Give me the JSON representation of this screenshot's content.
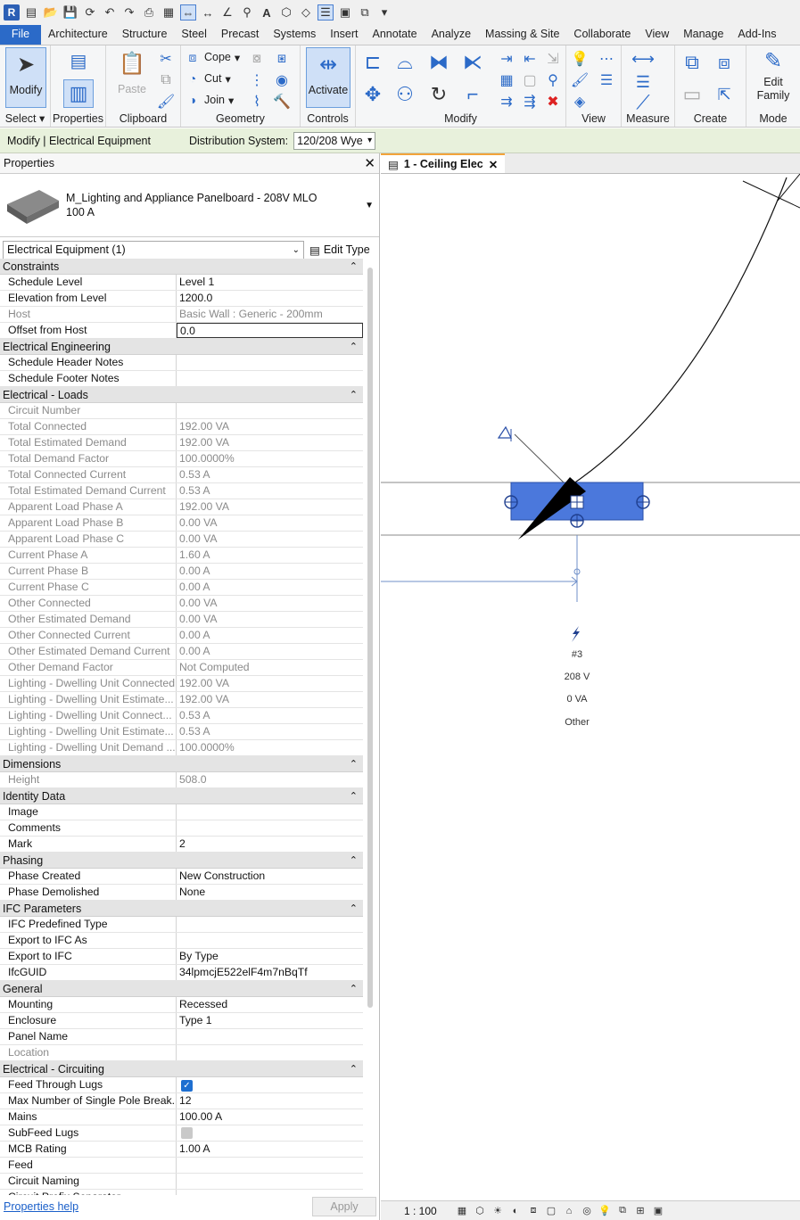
{
  "qat": {
    "app": "R"
  },
  "tabs": [
    "File",
    "Architecture",
    "Structure",
    "Steel",
    "Precast",
    "Systems",
    "Insert",
    "Annotate",
    "Analyze",
    "Massing & Site",
    "Collaborate",
    "View",
    "Manage",
    "Add-Ins"
  ],
  "ribbon": {
    "select": {
      "modify": "Modify",
      "panel": "Select"
    },
    "properties": {
      "panel": "Properties"
    },
    "clipboard": {
      "paste": "Paste",
      "panel": "Clipboard"
    },
    "geometry": {
      "cope": "Cope",
      "cut": "Cut",
      "join": "Join",
      "panel": "Geometry"
    },
    "controls": {
      "activate": "Activate",
      "panel": "Controls"
    },
    "modify": {
      "panel": "Modify"
    },
    "view": {
      "panel": "View"
    },
    "measure": {
      "panel": "Measure"
    },
    "create": {
      "panel": "Create"
    },
    "mode": {
      "edit_family": "Edit Family",
      "panel": "Mode"
    }
  },
  "optionsbar": {
    "context": "Modify | Electrical Equipment",
    "dist_label": "Distribution System:",
    "dist_value": "120/208 Wye"
  },
  "properties": {
    "title": "Properties",
    "type_name": "M_Lighting and Appliance Panelboard - 208V MLO",
    "type_sub": "100 A",
    "filter": "Electrical Equipment (1)",
    "edit_type": "Edit Type",
    "help": "Properties help",
    "apply": "Apply",
    "groups": [
      {
        "name": "Constraints",
        "rows": [
          {
            "k": "Schedule Level",
            "v": "Level 1"
          },
          {
            "k": "Elevation from Level",
            "v": "1200.0"
          },
          {
            "k": "Host",
            "v": "Basic Wall : Generic - 200mm",
            "ro": true
          },
          {
            "k": "Offset from Host",
            "v": "0.0",
            "edit": true
          }
        ]
      },
      {
        "name": "Electrical Engineering",
        "rows": [
          {
            "k": "Schedule Header Notes",
            "v": ""
          },
          {
            "k": "Schedule Footer Notes",
            "v": ""
          }
        ]
      },
      {
        "name": "Electrical - Loads",
        "rows": [
          {
            "k": "Circuit Number",
            "v": "",
            "ro": true
          },
          {
            "k": "Total Connected",
            "v": "192.00 VA",
            "ro": true
          },
          {
            "k": "Total Estimated Demand",
            "v": "192.00 VA",
            "ro": true
          },
          {
            "k": "Total Demand Factor",
            "v": "100.0000%",
            "ro": true
          },
          {
            "k": "Total Connected Current",
            "v": "0.53 A",
            "ro": true
          },
          {
            "k": "Total Estimated Demand Current",
            "v": "0.53 A",
            "ro": true
          },
          {
            "k": "Apparent Load Phase A",
            "v": "192.00 VA",
            "ro": true
          },
          {
            "k": "Apparent Load Phase B",
            "v": "0.00 VA",
            "ro": true
          },
          {
            "k": "Apparent Load Phase C",
            "v": "0.00 VA",
            "ro": true
          },
          {
            "k": "Current Phase A",
            "v": "1.60 A",
            "ro": true
          },
          {
            "k": "Current Phase B",
            "v": "0.00 A",
            "ro": true
          },
          {
            "k": "Current Phase C",
            "v": "0.00 A",
            "ro": true
          },
          {
            "k": "Other Connected",
            "v": "0.00 VA",
            "ro": true
          },
          {
            "k": "Other Estimated Demand",
            "v": "0.00 VA",
            "ro": true
          },
          {
            "k": "Other Connected Current",
            "v": "0.00 A",
            "ro": true
          },
          {
            "k": "Other Estimated Demand Current",
            "v": "0.00 A",
            "ro": true
          },
          {
            "k": "Other Demand Factor",
            "v": "Not Computed",
            "ro": true
          },
          {
            "k": "Lighting - Dwelling Unit Connected",
            "v": "192.00 VA",
            "ro": true
          },
          {
            "k": "Lighting - Dwelling Unit Estimate...",
            "v": "192.00 VA",
            "ro": true
          },
          {
            "k": "Lighting - Dwelling Unit Connect...",
            "v": "0.53 A",
            "ro": true
          },
          {
            "k": "Lighting - Dwelling Unit Estimate...",
            "v": "0.53 A",
            "ro": true
          },
          {
            "k": "Lighting - Dwelling Unit Demand ...",
            "v": "100.0000%",
            "ro": true
          }
        ]
      },
      {
        "name": "Dimensions",
        "rows": [
          {
            "k": "Height",
            "v": "508.0",
            "ro": true
          }
        ]
      },
      {
        "name": "Identity Data",
        "rows": [
          {
            "k": "Image",
            "v": ""
          },
          {
            "k": "Comments",
            "v": ""
          },
          {
            "k": "Mark",
            "v": "2"
          }
        ]
      },
      {
        "name": "Phasing",
        "rows": [
          {
            "k": "Phase Created",
            "v": "New Construction"
          },
          {
            "k": "Phase Demolished",
            "v": "None"
          }
        ]
      },
      {
        "name": "IFC Parameters",
        "rows": [
          {
            "k": "IFC Predefined Type",
            "v": ""
          },
          {
            "k": "Export to IFC As",
            "v": ""
          },
          {
            "k": "Export to IFC",
            "v": "By Type"
          },
          {
            "k": "IfcGUID",
            "v": "34lpmcjE522elF4m7nBqTf"
          }
        ]
      },
      {
        "name": "General",
        "rows": [
          {
            "k": "Mounting",
            "v": "Recessed"
          },
          {
            "k": "Enclosure",
            "v": "Type 1"
          },
          {
            "k": "Panel Name",
            "v": ""
          },
          {
            "k": "Location",
            "v": "",
            "ro": true
          }
        ]
      },
      {
        "name": "Electrical - Circuiting",
        "rows": [
          {
            "k": "Feed Through Lugs",
            "v": "",
            "check": "on"
          },
          {
            "k": "Max Number of Single Pole Break...",
            "v": "12"
          },
          {
            "k": "Mains",
            "v": "100.00 A"
          },
          {
            "k": "SubFeed Lugs",
            "v": "",
            "check": "off"
          },
          {
            "k": "MCB Rating",
            "v": "1.00 A"
          },
          {
            "k": "Feed",
            "v": ""
          },
          {
            "k": "Circuit Naming",
            "v": ""
          },
          {
            "k": "Circuit Prefix Separator",
            "v": ""
          }
        ]
      }
    ]
  },
  "view": {
    "tab": "1 - Ceiling Elec",
    "scale": "1 : 100",
    "tag": {
      "circuit": "#3",
      "voltage": "208 V",
      "load": "0 VA",
      "type": "Other"
    }
  }
}
